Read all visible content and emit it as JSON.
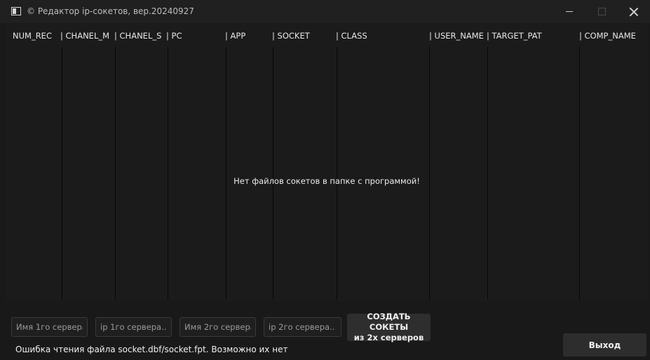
{
  "window": {
    "title": "© Редактор ip-сокетов, вер.20240927"
  },
  "table": {
    "columns": [
      {
        "label": "NUM_REC"
      },
      {
        "label": "| CHANEL_M"
      },
      {
        "label": "| CHANEL_S"
      },
      {
        "label": "| PC"
      },
      {
        "label": "| APP"
      },
      {
        "label": "| SOCKET"
      },
      {
        "label": "| CLASS"
      },
      {
        "label": "| USER_NAME"
      },
      {
        "label": "| TARGET_PAT"
      },
      {
        "label": "| COMP_NAME"
      }
    ],
    "empty_message": "Нет файлов сокетов в папке с программой!"
  },
  "form": {
    "server1_name_placeholder": "Имя 1го сервера..",
    "server1_ip_placeholder": "ip 1го сервера..",
    "server2_name_placeholder": "Имя 2го сервера..",
    "server2_ip_placeholder": "ip 2го сервера..",
    "create_button_line1": "СОЗДАТЬ СОКЕТЫ",
    "create_button_line2": "из 2х серверов"
  },
  "status": {
    "message": "Ошибка чтения файла socket.dbf/socket.fpt. Возможно их нет"
  },
  "footer": {
    "exit_label": "Выход"
  }
}
